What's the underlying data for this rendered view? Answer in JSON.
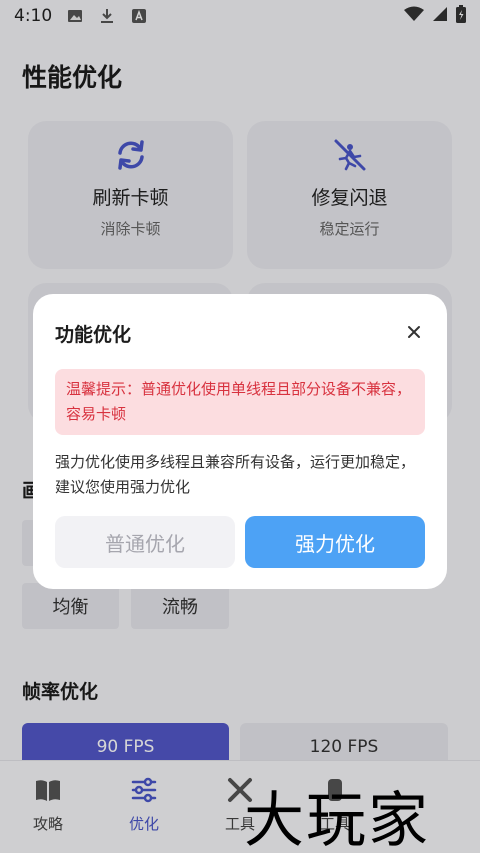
{
  "status_bar": {
    "time": "4:10",
    "icons": [
      "image-icon",
      "download-icon",
      "font-icon",
      "wifi-icon",
      "signal-icon",
      "battery-icon"
    ]
  },
  "page": {
    "title": "性能优化"
  },
  "cards": [
    {
      "title": "刷新卡顿",
      "subtitle": "消除卡顿",
      "icon": "refresh-icon"
    },
    {
      "title": "修复闪退",
      "subtitle": "稳定运行",
      "icon": "crash-fix-icon"
    }
  ],
  "picture_section": {
    "label_partial": "画",
    "chips": [
      "均衡",
      "流畅"
    ]
  },
  "fps_section": {
    "title": "帧率优化",
    "options": [
      "90 FPS",
      "120 FPS"
    ],
    "selected": "90 FPS"
  },
  "bottom_nav": {
    "items": [
      {
        "label": "攻略",
        "icon": "book-icon"
      },
      {
        "label": "优化",
        "icon": "sliders-icon",
        "active": true
      },
      {
        "label": "工具",
        "icon": "tools-icon"
      },
      {
        "label": "工具",
        "icon": "tools-icon-2"
      }
    ]
  },
  "watermark": {
    "text": "大玩家"
  },
  "dialog": {
    "title": "功能优化",
    "alert_text": "温馨提示：普通优化使用单线程且部分设备不兼容，容易卡顿",
    "description": "强力优化使用多线程且兼容所有设备，运行更加稳定，建议您使用强力优化",
    "normal_button": "普通优化",
    "strong_button": "强力优化"
  },
  "colors": {
    "accent": "#4a56c9",
    "primary_button": "#4da2f5",
    "alert_bg": "#fcdde0",
    "alert_text": "#d8323f"
  }
}
